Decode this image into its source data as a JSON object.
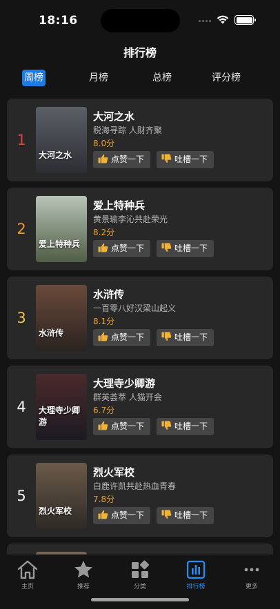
{
  "status_bar": {
    "time": "18:16"
  },
  "page_title": "排行榜",
  "tabs": [
    {
      "label": "周榜",
      "active": true
    },
    {
      "label": "月榜",
      "active": false
    },
    {
      "label": "总榜",
      "active": false
    },
    {
      "label": "评分榜",
      "active": false
    }
  ],
  "buttons": {
    "like": "点赞一下",
    "dislike": "吐槽一下"
  },
  "items": [
    {
      "rank": "1",
      "rank_color": "#e0413a",
      "title": "大河之水",
      "subtitle": "税海寻踪 人财齐聚",
      "score": "8.0分",
      "poster_text": "大河之水",
      "poster_colors": [
        "#5b6066",
        "#2b2e33"
      ]
    },
    {
      "rank": "2",
      "rank_color": "#e89a2c",
      "title": "爱上特种兵",
      "subtitle": "黄景瑜李沁共赴荣光",
      "score": "8.2分",
      "poster_text": "爱上特种兵",
      "poster_colors": [
        "#b9c4b8",
        "#4f5e44"
      ]
    },
    {
      "rank": "3",
      "rank_color": "#f0c33c",
      "title": "水浒传",
      "subtitle": "一百零八好汉梁山起义",
      "score": "8.1分",
      "poster_text": "水浒传",
      "poster_colors": [
        "#6a4a3a",
        "#2a2320"
      ]
    },
    {
      "rank": "4",
      "rank_color": "#f2f2f2",
      "title": "大理寺少卿游",
      "subtitle": "群英荟萃 人猫开会",
      "score": "6.7分",
      "poster_text": "大理寺少卿游",
      "poster_colors": [
        "#4a2a2c",
        "#1c1a22"
      ]
    },
    {
      "rank": "5",
      "rank_color": "#f2f2f2",
      "title": "烈火军校",
      "subtitle": "白鹿许凯共赴热血青春",
      "score": "7.8分",
      "poster_text": "烈火军校",
      "poster_colors": [
        "#6b5a48",
        "#2e2a26"
      ]
    }
  ],
  "tabbar": [
    {
      "label": "主页",
      "icon": "home-icon",
      "active": false
    },
    {
      "label": "推荐",
      "icon": "star-icon",
      "active": false
    },
    {
      "label": "分类",
      "icon": "category-grid-icon",
      "active": false
    },
    {
      "label": "排行榜",
      "icon": "ranking-chart-icon",
      "active": true
    },
    {
      "label": "更多",
      "icon": "more-dots-icon",
      "active": false
    }
  ],
  "colors": {
    "accent": "#1e7ae6",
    "score": "#e8a23a",
    "card_bg": "#282828"
  }
}
